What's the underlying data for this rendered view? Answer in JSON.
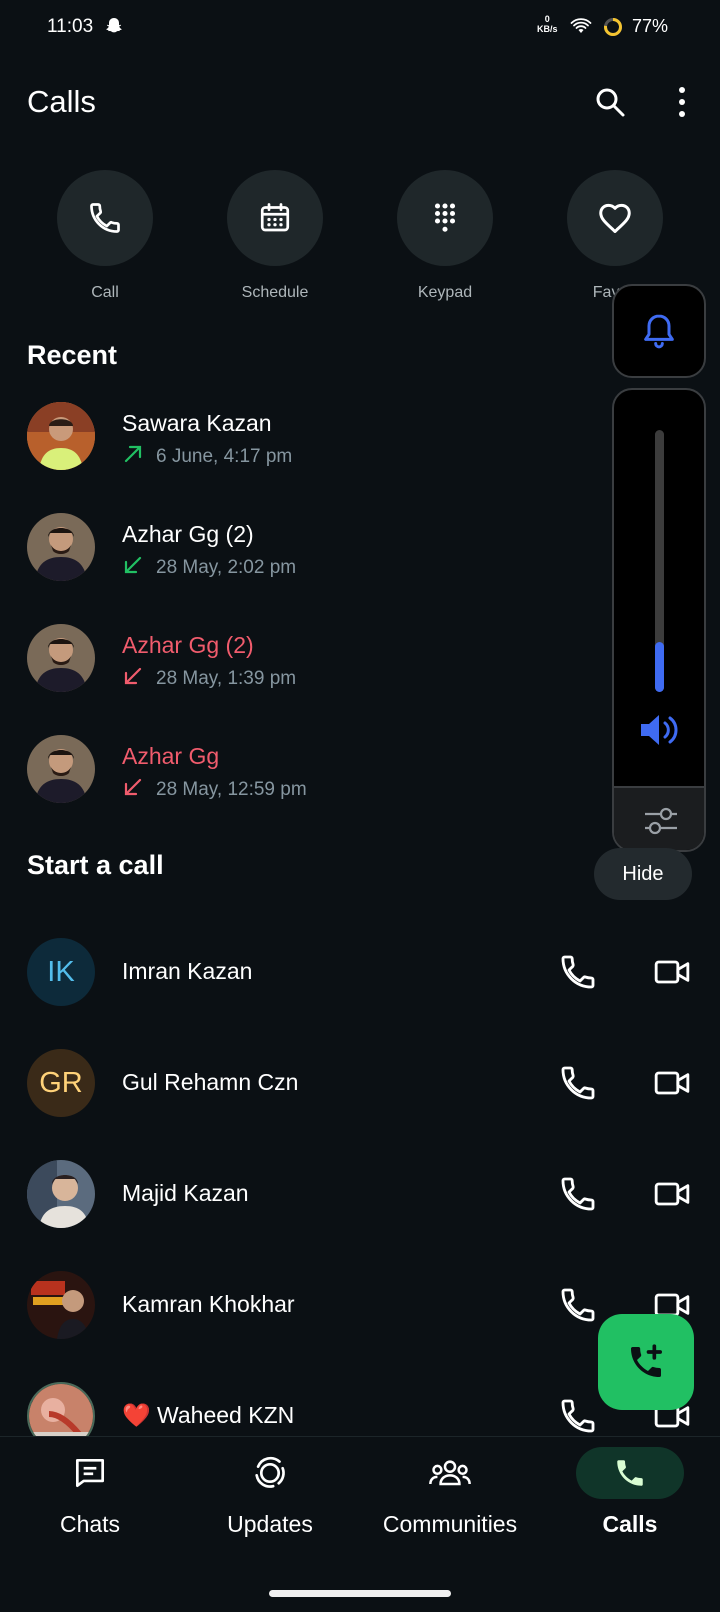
{
  "status": {
    "time": "11:03",
    "net_speed_value": "0",
    "net_speed_unit": "KB/s",
    "battery": "77%"
  },
  "header": {
    "title": "Calls",
    "search_icon": "search-icon",
    "more_icon": "more-vert-icon"
  },
  "quick_actions": [
    {
      "label": "Call",
      "icon": "phone-icon"
    },
    {
      "label": "Schedule",
      "icon": "calendar-icon"
    },
    {
      "label": "Keypad",
      "icon": "keypad-icon"
    },
    {
      "label": "Favori",
      "icon": "heart-icon"
    }
  ],
  "recent": {
    "title": "Recent",
    "items": [
      {
        "name": "Sawara Kazan",
        "time": "6 June, 4:17 pm",
        "direction": "outgoing",
        "missed": false
      },
      {
        "name": "Azhar Gg (2)",
        "time": "28 May, 2:02 pm",
        "direction": "incoming",
        "missed": false
      },
      {
        "name": "Azhar Gg (2)",
        "time": "28 May, 1:39 pm",
        "direction": "incoming",
        "missed": true
      },
      {
        "name": "Azhar Gg",
        "time": "28 May, 12:59 pm",
        "direction": "incoming",
        "missed": true
      }
    ]
  },
  "start_call": {
    "title": "Start a call",
    "contacts": [
      {
        "name": "Imran Kazan",
        "initials": "IK",
        "avatar_bg": "#0d2a3a",
        "avatar_fg": "#53bdeb"
      },
      {
        "name": "Gul Rehamn Czn",
        "initials": "GR",
        "avatar_bg": "#3a2a18",
        "avatar_fg": "#ffd279"
      },
      {
        "name": "Majid Kazan",
        "initials": "",
        "avatar_bg": "#6a7a8c",
        "avatar_fg": "#ffffff"
      },
      {
        "name": "Kamran Khokhar",
        "initials": "",
        "avatar_bg": "#3a1c14",
        "avatar_fg": "#ffffff"
      },
      {
        "name": "❤️ Waheed KZN",
        "initials": "",
        "avatar_bg": "#7a4a3c",
        "avatar_fg": "#ffffff"
      }
    ]
  },
  "volume_overlay": {
    "level": 0.19,
    "hide_label": "Hide",
    "accent": "#3f6bf2"
  },
  "fab": {
    "icon": "add-call-icon",
    "color": "#21c063"
  },
  "nav": [
    {
      "label": "Chats",
      "icon": "chats-icon",
      "active": false
    },
    {
      "label": "Updates",
      "icon": "updates-icon",
      "active": false
    },
    {
      "label": "Communities",
      "icon": "communities-icon",
      "active": false
    },
    {
      "label": "Calls",
      "icon": "calls-icon",
      "active": true
    }
  ],
  "colors": {
    "background": "#0b1014",
    "missed": "#f15c6d",
    "outgoing": "#21c063",
    "accent_green": "#21c063"
  }
}
